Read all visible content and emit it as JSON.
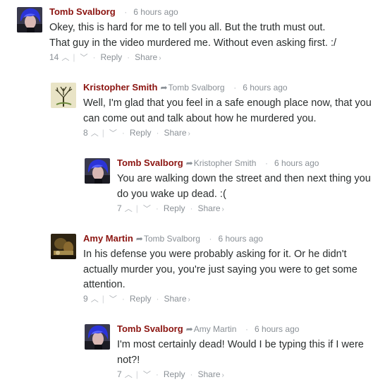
{
  "comments": [
    {
      "author": "Tomb Svalborg",
      "reply_to": "",
      "time": "6 hours ago",
      "text": "Okey, this is hard for me to tell you all. But the truth must out. That guy in the video murdered me. Without even asking first. :/",
      "votes": "14",
      "reply_label": "Reply",
      "share_label": "Share",
      "avatar": "blue-hair-person"
    },
    {
      "author": "Kristopher Smith",
      "reply_to": "Tomb Svalborg",
      "time": "6 hours ago",
      "text": "Well, I'm glad that you feel in a safe enough place now, that you can come out and talk about how he murdered you.",
      "votes": "8",
      "reply_label": "Reply",
      "share_label": "Share",
      "avatar": "bare-tree"
    },
    {
      "author": "Tomb Svalborg",
      "reply_to": "Kristopher Smith",
      "time": "6 hours ago",
      "text": "You are walking down the street and then next thing you do you wake up dead. :(",
      "votes": "7",
      "reply_label": "Reply",
      "share_label": "Share",
      "avatar": "blue-hair-person"
    },
    {
      "author": "Amy Martin",
      "reply_to": "Tomb Svalborg",
      "time": "6 hours ago",
      "text": "In his defense you were probably asking for it. Or he didn't actually murder you, you're just saying you were to get some attention.",
      "votes": "9",
      "reply_label": "Reply",
      "share_label": "Share",
      "avatar": "dark-scene"
    },
    {
      "author": "Tomb Svalborg",
      "reply_to": "Amy Martin",
      "time": "6 hours ago",
      "text": "I'm most certainly dead! Would I be typing this if I were not?!",
      "votes": "7",
      "reply_label": "Reply",
      "share_label": "Share",
      "avatar": "blue-hair-person"
    }
  ]
}
